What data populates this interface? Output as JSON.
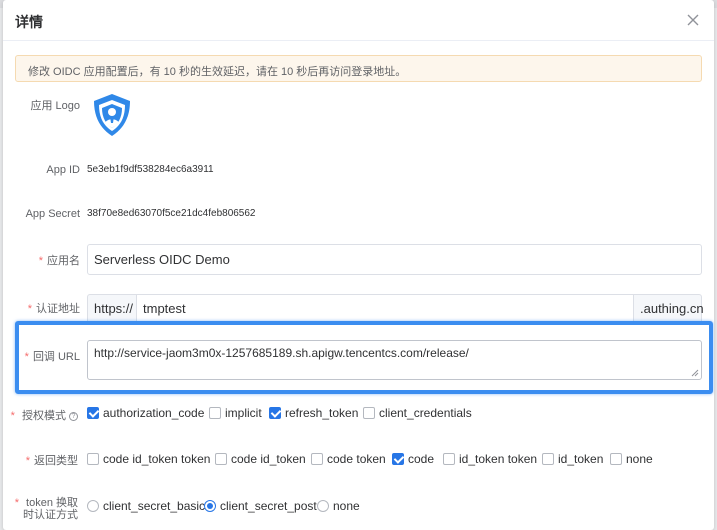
{
  "dialog": {
    "title": "详情"
  },
  "notice": "修改 OIDC 应用配置后，有 10 秒的生效延迟，请在 10 秒后再访问登录地址。",
  "fields": {
    "logo_label": "应用 Logo",
    "app_id_label": "App ID",
    "app_id_value": "5e3eb1f9df538284ec6a3911",
    "app_secret_label": "App Secret",
    "app_secret_value": "38f70e8ed63070f5ce21dc4feb806562",
    "app_name_label": "应用名",
    "app_name_value": "Serverless OIDC Demo",
    "auth_url_label": "认证地址",
    "auth_url_prefix": "https://",
    "auth_url_value": "tmptest",
    "auth_url_suffix": ".authing.cn",
    "callback_label": "回调 URL",
    "callback_value": "http://service-jaom3m0x-1257685189.sh.apigw.tencentcs.com/release/"
  },
  "grant_types": {
    "label": "授权模式",
    "options": [
      {
        "label": "authorization_code",
        "checked": true
      },
      {
        "label": "implicit",
        "checked": false
      },
      {
        "label": "refresh_token",
        "checked": true
      },
      {
        "label": "client_credentials",
        "checked": false
      }
    ]
  },
  "response_types": {
    "label": "返回类型",
    "options": [
      {
        "label": "code id_token token",
        "checked": false
      },
      {
        "label": "code id_token",
        "checked": false
      },
      {
        "label": "code token",
        "checked": false
      },
      {
        "label": "code",
        "checked": true
      },
      {
        "label": "id_token token",
        "checked": false
      },
      {
        "label": "id_token",
        "checked": false
      },
      {
        "label": "none",
        "checked": false
      }
    ]
  },
  "token_auth": {
    "label_line1": "token 换取",
    "label_line2": "时认证方式",
    "options": [
      {
        "label": "client_secret_basic",
        "selected": false
      },
      {
        "label": "client_secret_post",
        "selected": true
      },
      {
        "label": "none",
        "selected": false
      }
    ]
  },
  "colors": {
    "primary": "#2776e6",
    "required": "#f56c6c",
    "highlight": "#3b8df0",
    "notice_bg": "#fdf6ec",
    "notice_border": "#f5dab1"
  }
}
